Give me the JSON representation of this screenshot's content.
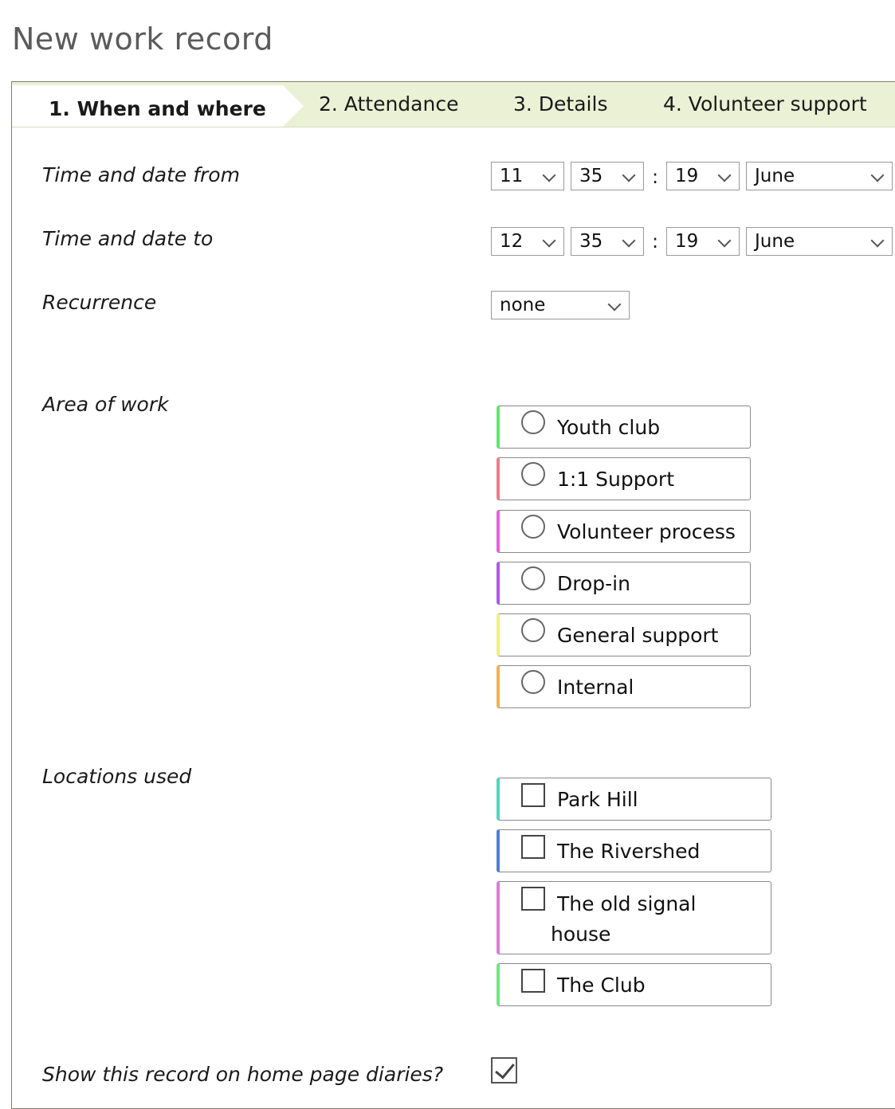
{
  "page": {
    "title": "New work record"
  },
  "tabs": [
    {
      "label": "1. When and where",
      "active": true
    },
    {
      "label": "2. Attendance",
      "active": false
    },
    {
      "label": "3. Details",
      "active": false
    },
    {
      "label": "4. Volunteer support",
      "active": false
    }
  ],
  "time_from": {
    "label": "Time and date from",
    "hour": "11",
    "minute": "35",
    "day": "19",
    "month": "June"
  },
  "time_to": {
    "label": "Time and date to",
    "hour": "12",
    "minute": "35",
    "day": "19",
    "month": "June"
  },
  "separator": ":",
  "recurrence": {
    "label": "Recurrence",
    "value": "none"
  },
  "area_of_work": {
    "label": "Area of work",
    "options": [
      {
        "label": "Youth club",
        "color": "#5ee86e",
        "selected": false
      },
      {
        "label": "1:1 Support",
        "color": "#f27a86",
        "selected": false
      },
      {
        "label": "Volunteer process",
        "color": "#e85ce8",
        "selected": false
      },
      {
        "label": "Drop-in",
        "color": "#b256ee",
        "selected": false
      },
      {
        "label": "General support",
        "color": "#f0f27a",
        "selected": false
      },
      {
        "label": "Internal",
        "color": "#f5b04e",
        "selected": false
      }
    ]
  },
  "locations": {
    "label": "Locations used",
    "options": [
      {
        "label": "Park Hill",
        "color": "#4fd6c0",
        "checked": false
      },
      {
        "label": "The Rivershed",
        "color": "#4f7ed6",
        "checked": false
      },
      {
        "label": "The old signal house",
        "color": "#e07ad8",
        "checked": false
      },
      {
        "label": "The Club",
        "color": "#6ee87e",
        "checked": false
      }
    ]
  },
  "home_page": {
    "label": "Show this record on home page diaries?",
    "checked": true
  }
}
